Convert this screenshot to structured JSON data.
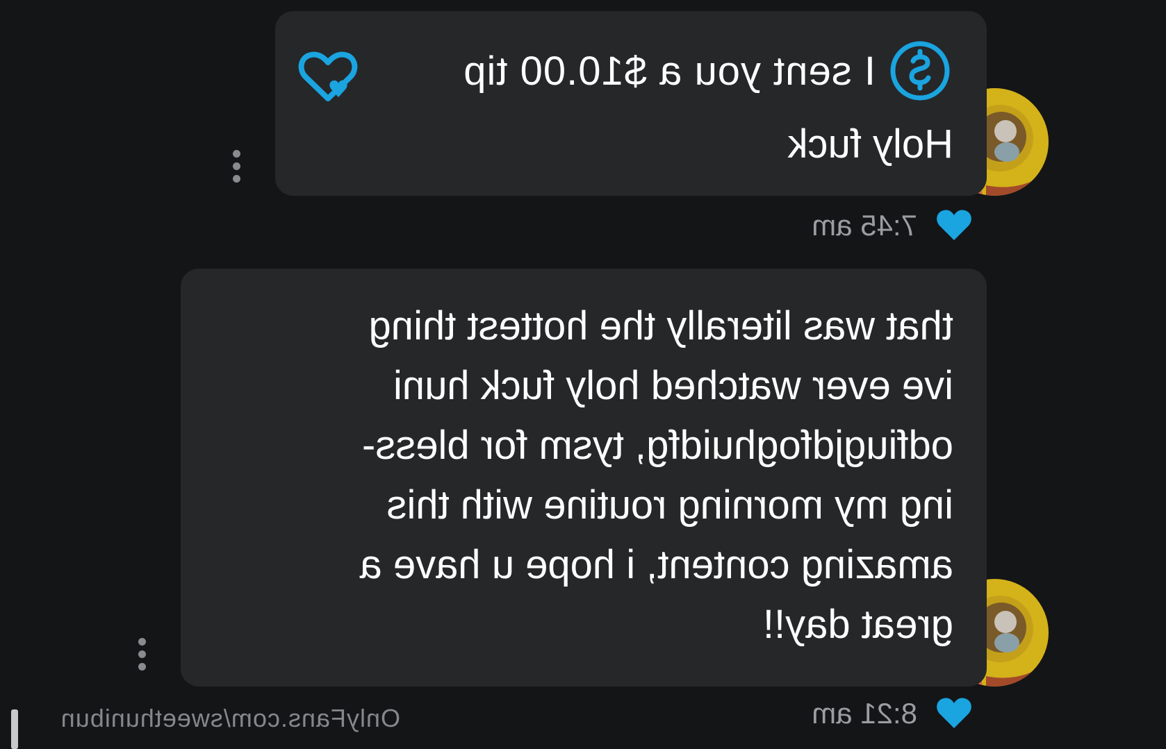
{
  "colors": {
    "background": "#141517",
    "bubble": "#262729",
    "accent": "#1aa4e0",
    "text": "#ffffff",
    "muted": "#9c9da1"
  },
  "messages": [
    {
      "tip_text": "I sent you a $10.00 tip",
      "tip_icon": "dollar-circle-icon",
      "reaction_icon": "heart-plus-icon",
      "text": "Holy fuck",
      "time": "7:45 am",
      "like_icon": "heart-icon",
      "menu_icon": "more-vertical-icon",
      "avatar": "avatar"
    },
    {
      "text_lines": [
        "that was literally the hottest thing",
        "ive ever watched holy fuck huni",
        "odfiugjdfoghuidfg, tysm for bless-",
        "ing my morning routine with this",
        "amazing content, i hope u have a",
        "great day!!"
      ],
      "time": "8:21 am",
      "like_icon": "heart-icon",
      "menu_icon": "more-vertical-icon",
      "avatar": "avatar"
    }
  ],
  "watermark": "OnlyFans.com/sweethunibun"
}
